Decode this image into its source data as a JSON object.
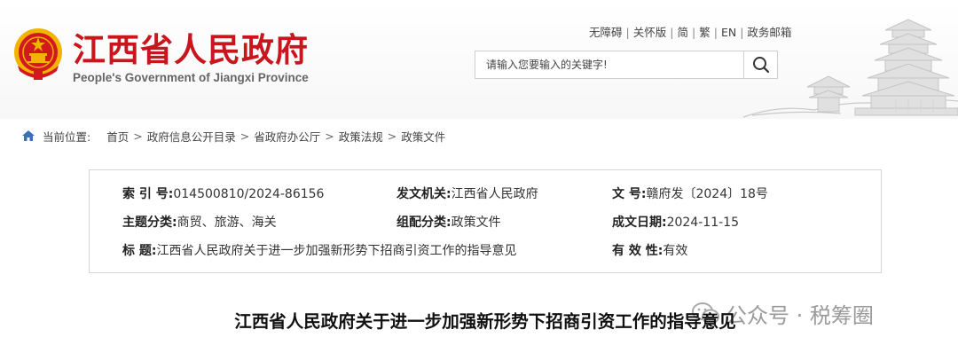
{
  "header": {
    "site_title": "江西省人民政府",
    "site_subtitle": "People's Government of Jiangxi Province",
    "top_links": [
      "无障碍",
      "关怀版",
      "简",
      "繁",
      "EN",
      "政务邮箱"
    ],
    "search_placeholder": "请输入您要输入的关键字!"
  },
  "breadcrumb": {
    "label": "当前位置:",
    "items": [
      "首页",
      "政府信息公开目录",
      "省政府办公厅",
      "政策法规",
      "政策文件"
    ],
    "separator": ">"
  },
  "metadata": {
    "index_label": "索 引 号:",
    "index_value": "014500810/2024-86156",
    "issuer_label": "发文机关:",
    "issuer_value": "江西省人民政府",
    "docno_label": "文 号:",
    "docno_value": "赣府发〔2024〕18号",
    "category_label": "主题分类:",
    "category_value": "商贸、旅游、海关",
    "genre_label": "组配分类:",
    "genre_value": "政策文件",
    "date_label": "成文日期:",
    "date_value": "2024-11-15",
    "title_label": "标 题:",
    "title_value": "江西省人民政府关于进一步加强新形势下招商引资工作的指导意见",
    "validity_label": "有 效 性:",
    "validity_value": "有效"
  },
  "watermark": {
    "text": "公众号 · 税筹圈"
  },
  "document": {
    "title": "江西省人民政府关于进一步加强新形势下招商引资工作的指导意见"
  },
  "colors": {
    "brand_red": "#c8161d",
    "emblem_gold": "#f2b400"
  },
  "icons": [
    "national-emblem-icon",
    "search-icon",
    "home-icon",
    "pavilion-illustration",
    "wechat-icon"
  ]
}
